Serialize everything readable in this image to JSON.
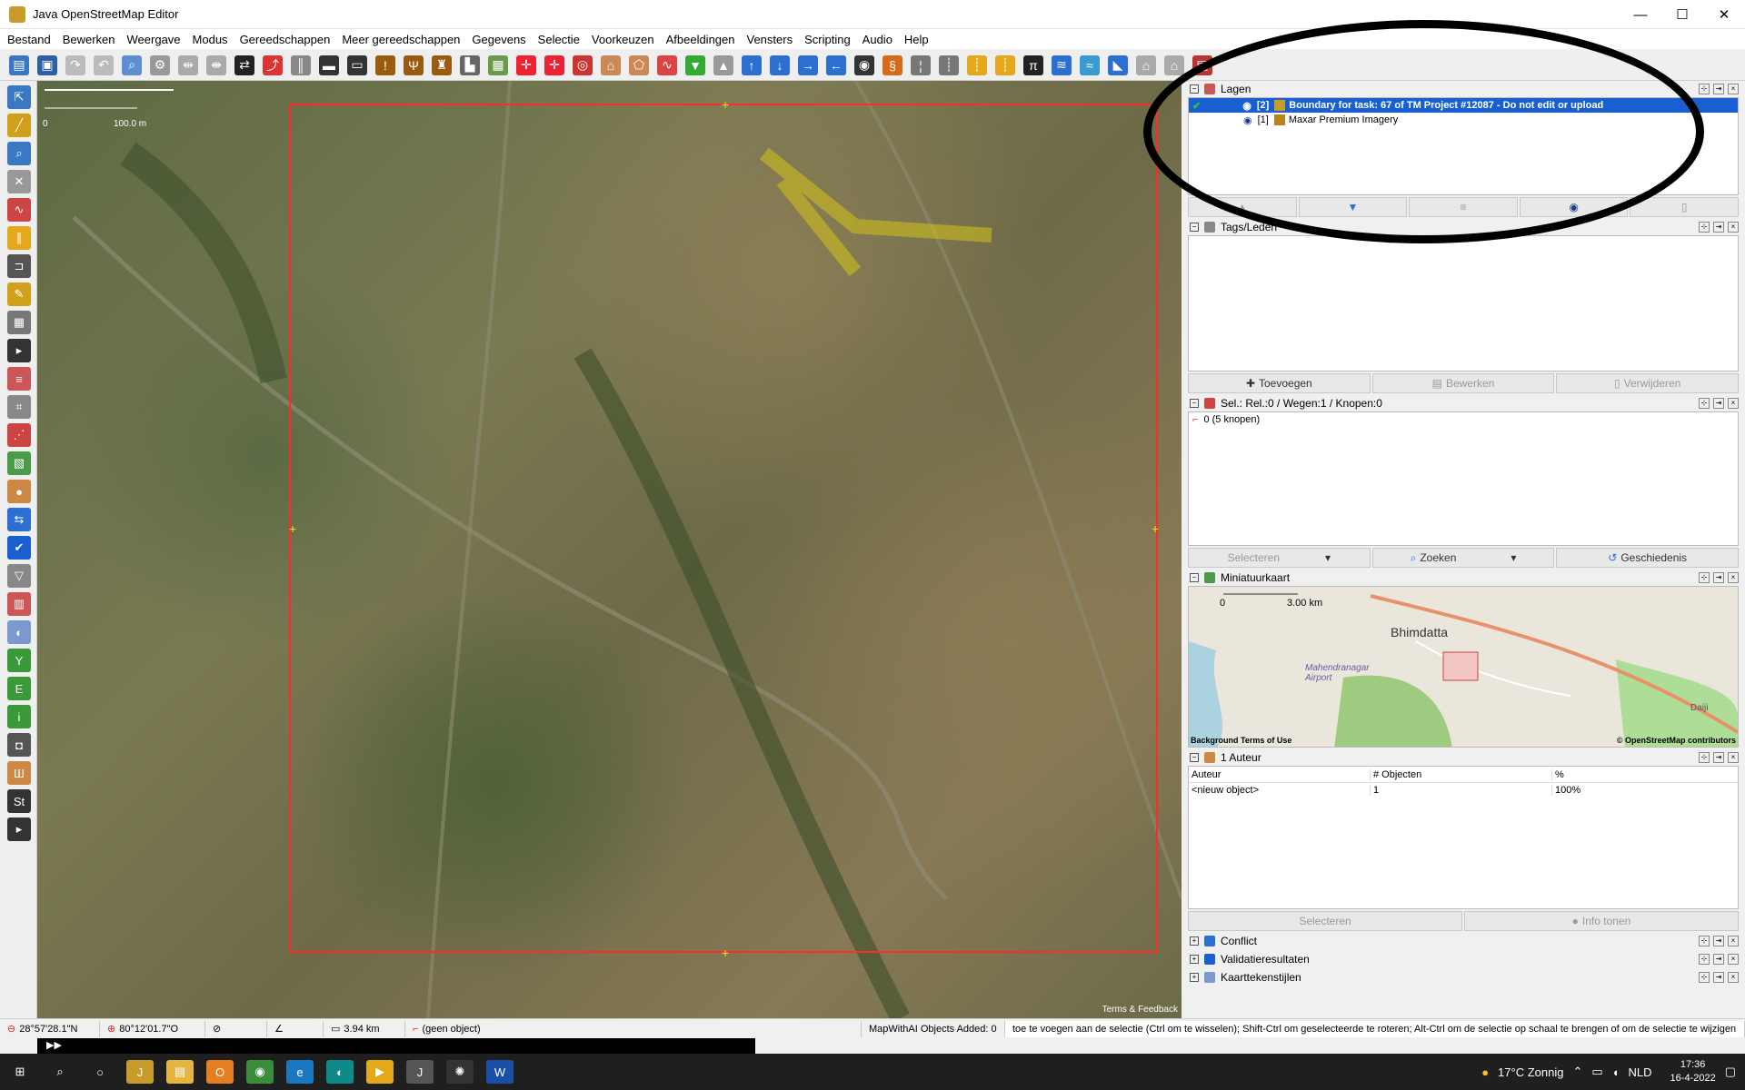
{
  "window": {
    "title": "Java OpenStreetMap Editor"
  },
  "menu": [
    "Bestand",
    "Bewerken",
    "Weergave",
    "Modus",
    "Gereedschappen",
    "Meer gereedschappen",
    "Gegevens",
    "Selectie",
    "Voorkeuzen",
    "Afbeeldingen",
    "Vensters",
    "Scripting",
    "Audio",
    "Help"
  ],
  "colors": {
    "accent": "#1a5fd1",
    "boundary": "#ff2a2a",
    "annotation": "#000000"
  },
  "map": {
    "scale_zero": "0",
    "scale_label": "100.0 m",
    "terms": "Terms & Feedback"
  },
  "layers": {
    "title": "Lagen",
    "items": [
      {
        "index": "[2]",
        "name": "Boundary for task: 67 of TM Project #12087 - Do not edit or upload",
        "selected": true
      },
      {
        "index": "[1]",
        "name": "Maxar Premium Imagery",
        "selected": false
      }
    ]
  },
  "tags": {
    "title": "Tags/Leden",
    "add": "Toevoegen",
    "edit": "Bewerken",
    "remove": "Verwijderen"
  },
  "selection": {
    "title": "Sel.: Rel.:0 / Wegen:1 / Knopen:0",
    "item": "0 (5 knopen)",
    "select": "Selecteren",
    "search": "Zoeken",
    "history": "Geschiedenis"
  },
  "minimap": {
    "title": "Miniatuurkaart",
    "scale_zero": "0",
    "scale_label": "3.00 km",
    "city": "Bhimdatta",
    "airport": "Mahendranagar Airport",
    "place2": "Daiji",
    "bg_terms": "Background Terms of Use",
    "credit": "© OpenStreetMap contributors"
  },
  "authors": {
    "title": "1 Auteur",
    "col_author": "Auteur",
    "col_objects": "# Objecten",
    "col_pct": "%",
    "row_author": "<nieuw object>",
    "row_objects": "1",
    "row_pct": "100%",
    "select": "Selecteren",
    "info": "Info tonen"
  },
  "collapsed": {
    "conflict": "Conflict",
    "validation": "Validatieresultaten",
    "styles": "Kaarttekenstijlen"
  },
  "status": {
    "lat": "28°57'28.1\"N",
    "lon": "80°12'01.7\"O",
    "dist": "3.94 km",
    "object": "(geen object)",
    "mapwithai": "MapWithAI Objects Added: 0",
    "message": "toe te voegen aan de selectie (Ctrl om te wisselen); Shift-Ctrl om geselecteerde te roteren; Alt-Ctrl om de selectie op schaal te brengen of om de selectie te wijzigen"
  },
  "taskbar": {
    "weather": "17°C Zonnig",
    "lang": "NLD",
    "time": "17:36",
    "date": "16-4-2022"
  }
}
